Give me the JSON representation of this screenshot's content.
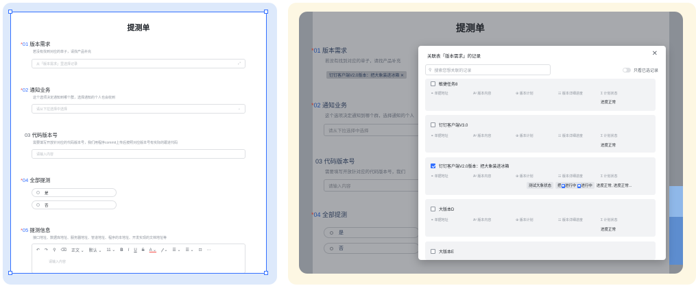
{
  "left": {
    "title": "提测单",
    "q1": {
      "num": "01",
      "label": "版本需求",
      "desc": "若没有找到对应的单子，请找产品补充",
      "placeholder": "从「版本需求」里选择记录"
    },
    "q2": {
      "num": "02",
      "label": "通知业务",
      "desc": "这个选项决定通知到哪个群，选择通知的个人也会收到",
      "placeholder": "请从下拉选择中选择"
    },
    "q3": {
      "num": "03",
      "label": "代码版本号",
      "desc": "需要填写开放针对应的代码版本号，我们用程序commit上传后按照对应版本号有实际的跟进代码",
      "placeholder": "请输入内容"
    },
    "q4": {
      "num": "04",
      "label": "全部提测",
      "options": [
        "是",
        "否"
      ]
    },
    "q5": {
      "num": "05",
      "label": "提测信息",
      "desc": "接口地址、数据库地址、服务器地址、管道地址、程序的本地址、开发实现的文档地址等",
      "placeholder": "请输入内容"
    },
    "toolbar": [
      "↶",
      "↷",
      "⚲",
      "⌫",
      "正文 ⌄",
      "默认 ⌄",
      "11 ⌄",
      "B",
      "I",
      "U",
      "S",
      "A ⌄",
      "𝒻 ⌄",
      "☰ ⌄",
      "☰ ⌄",
      "⊡",
      "⋯"
    ]
  },
  "right": {
    "title": "提测单",
    "q1": {
      "num": "01",
      "label": "版本需求",
      "desc": "若没有找到对应的单子，请找产品补充",
      "tag": "钉钉客户端V2.0版本：把大象装进冰箱 ✕"
    },
    "q2": {
      "num": "02",
      "label": "通知业务",
      "desc": "这个选项决定通知到哪个群，选择通知的个人",
      "placeholder": "请从下拉选择中选择"
    },
    "q3": {
      "num": "03",
      "label": "代码版本号",
      "desc": "需要填写开放针对应的代码版本号，我们",
      "placeholder": "请输入内容"
    },
    "q4": {
      "num": "04",
      "label": "全部提测",
      "options": [
        "是",
        "否"
      ]
    }
  },
  "modal": {
    "title": "关联表「版本需求」的记录",
    "close": "✕",
    "search_placeholder": "搜索您想关联的记录",
    "toggle_label": "只看已选记录",
    "fields": [
      "单据地址",
      "版本内容",
      "版本计划",
      "版本详细进度",
      "计划状态"
    ],
    "records": [
      {
        "name": "敏捷任务8",
        "checked": false,
        "status": "进度正常"
      },
      {
        "name": "钉钉客户端V3.0",
        "checked": false,
        "status": "进度正常"
      },
      {
        "name": "钉钉客户端V2.0版本：把大象装进冰箱",
        "checked": true,
        "tag1": "测试大象状态",
        "tag2a": "把",
        "tag2b": "进行中",
        "tag2c": "进行中",
        "status": "进度正常, 进度正常..."
      },
      {
        "name": "大版本D",
        "checked": false,
        "status": "进度正常"
      },
      {
        "name": "大版本E",
        "checked": false,
        "status": ""
      }
    ]
  },
  "colors": {
    "accent": "#3370ff",
    "required": "#f54a45",
    "left_bg": "#dde9fb",
    "right_bg": "#fdf7e3"
  }
}
